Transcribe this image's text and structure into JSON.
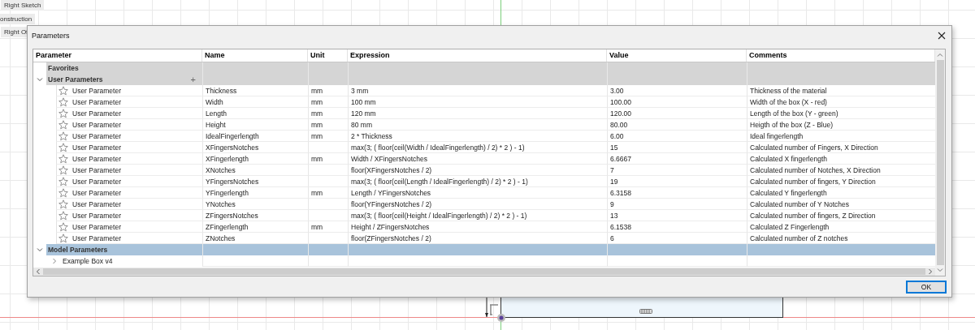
{
  "window": {
    "title": "Parameters"
  },
  "canvas_labels": [
    "Right Sketch",
    "onstruction",
    "Right Of"
  ],
  "table": {
    "columns": [
      "Parameter",
      "Name",
      "Unit",
      "Expression",
      "Value",
      "Comments"
    ],
    "groups": [
      {
        "label": "Favorites",
        "selected": false
      },
      {
        "label": "User Parameters",
        "expanded": true,
        "selected": false,
        "add_button": "+",
        "children": [
          {
            "kind": "parameter",
            "favorite": false,
            "parameter": "User Parameter",
            "name": "Thickness",
            "unit": "mm",
            "expression": "3 mm",
            "value": "3.00",
            "comment": "Thickness of the material"
          },
          {
            "kind": "parameter",
            "favorite": false,
            "parameter": "User Parameter",
            "name": "Width",
            "unit": "mm",
            "expression": "100 mm",
            "value": "100.00",
            "comment": "Width of the box (X - red)"
          },
          {
            "kind": "parameter",
            "favorite": false,
            "parameter": "User Parameter",
            "name": "Length",
            "unit": "mm",
            "expression": "120 mm",
            "value": "120.00",
            "comment": "Length of the box (Y - green)"
          },
          {
            "kind": "parameter",
            "favorite": false,
            "parameter": "User Parameter",
            "name": "Height",
            "unit": "mm",
            "expression": "80 mm",
            "value": "80.00",
            "comment": "Heigth of the box (Z - Blue)"
          },
          {
            "kind": "parameter",
            "favorite": false,
            "parameter": "User Parameter",
            "name": "IdealFingerlength",
            "unit": "mm",
            "expression": "2 * Thickness",
            "value": "6.00",
            "comment": "Ideal fingerlength"
          },
          {
            "kind": "parameter",
            "favorite": false,
            "parameter": "User Parameter",
            "name": "XFingersNotches",
            "expression": "max(3; ( floor(ceil(Width / IdealFingerlength) / 2) * 2 ) - 1)",
            "value": "15",
            "comment": "Calculated number of Fingers, X Direction"
          },
          {
            "kind": "parameter",
            "favorite": false,
            "parameter": "User Parameter",
            "name": "XFingerlength",
            "unit": "mm",
            "expression": "Width / XFingersNotches",
            "value": "6.6667",
            "comment": "Calculated X fingerlength"
          },
          {
            "kind": "parameter",
            "favorite": false,
            "parameter": "User Parameter",
            "name": "XNotches",
            "expression": "floor(XFingersNotches / 2)",
            "value": "7",
            "comment": "Calculated number of Notches, X Direction"
          },
          {
            "kind": "parameter",
            "favorite": false,
            "parameter": "User Parameter",
            "name": "YFingersNotches",
            "expression": "max(3; ( floor(ceil(Length / IdealFingerlength) / 2) * 2 ) - 1)",
            "value": "19",
            "comment": "Calculated number of fingers, Y Direction"
          },
          {
            "kind": "parameter",
            "favorite": false,
            "parameter": "User Parameter",
            "name": "YFingerlength",
            "unit": "mm",
            "expression": "Length / YFingersNotches",
            "value": "6.3158",
            "comment": "Calculated Y fingerlength"
          },
          {
            "kind": "parameter",
            "favorite": false,
            "parameter": "User Parameter",
            "name": "YNotches",
            "expression": "floor(YFingersNotches / 2)",
            "value": "9",
            "comment": "Calculated number of Y Notches"
          },
          {
            "kind": "parameter",
            "favorite": false,
            "parameter": "User Parameter",
            "name": "ZFingersNotches",
            "expression": "max(3; ( floor(ceil(Height / IdealFingerlength) / 2) * 2 ) - 1)",
            "value": "13",
            "comment": "Calculated number of fingers, Z Direction"
          },
          {
            "kind": "parameter",
            "favorite": false,
            "parameter": "User Parameter",
            "name": "ZFingerlength",
            "unit": "mm",
            "expression": "Height / ZFingersNotches",
            "value": "6.1538",
            "comment": "Calculated Z Fingerlength"
          },
          {
            "kind": "parameter",
            "favorite": false,
            "parameter": "User Parameter",
            "name": "ZNotches",
            "expression": "floor(ZFingersNotches / 2)",
            "value": "6",
            "comment": "Calculated number of Z notches"
          }
        ]
      },
      {
        "label": "Model Parameters",
        "expanded": true,
        "selected": true,
        "children": [
          {
            "kind": "component",
            "label": "Example Box v4",
            "expanded": false
          }
        ]
      }
    ]
  },
  "buttons": [
    {
      "label": "OK"
    }
  ]
}
